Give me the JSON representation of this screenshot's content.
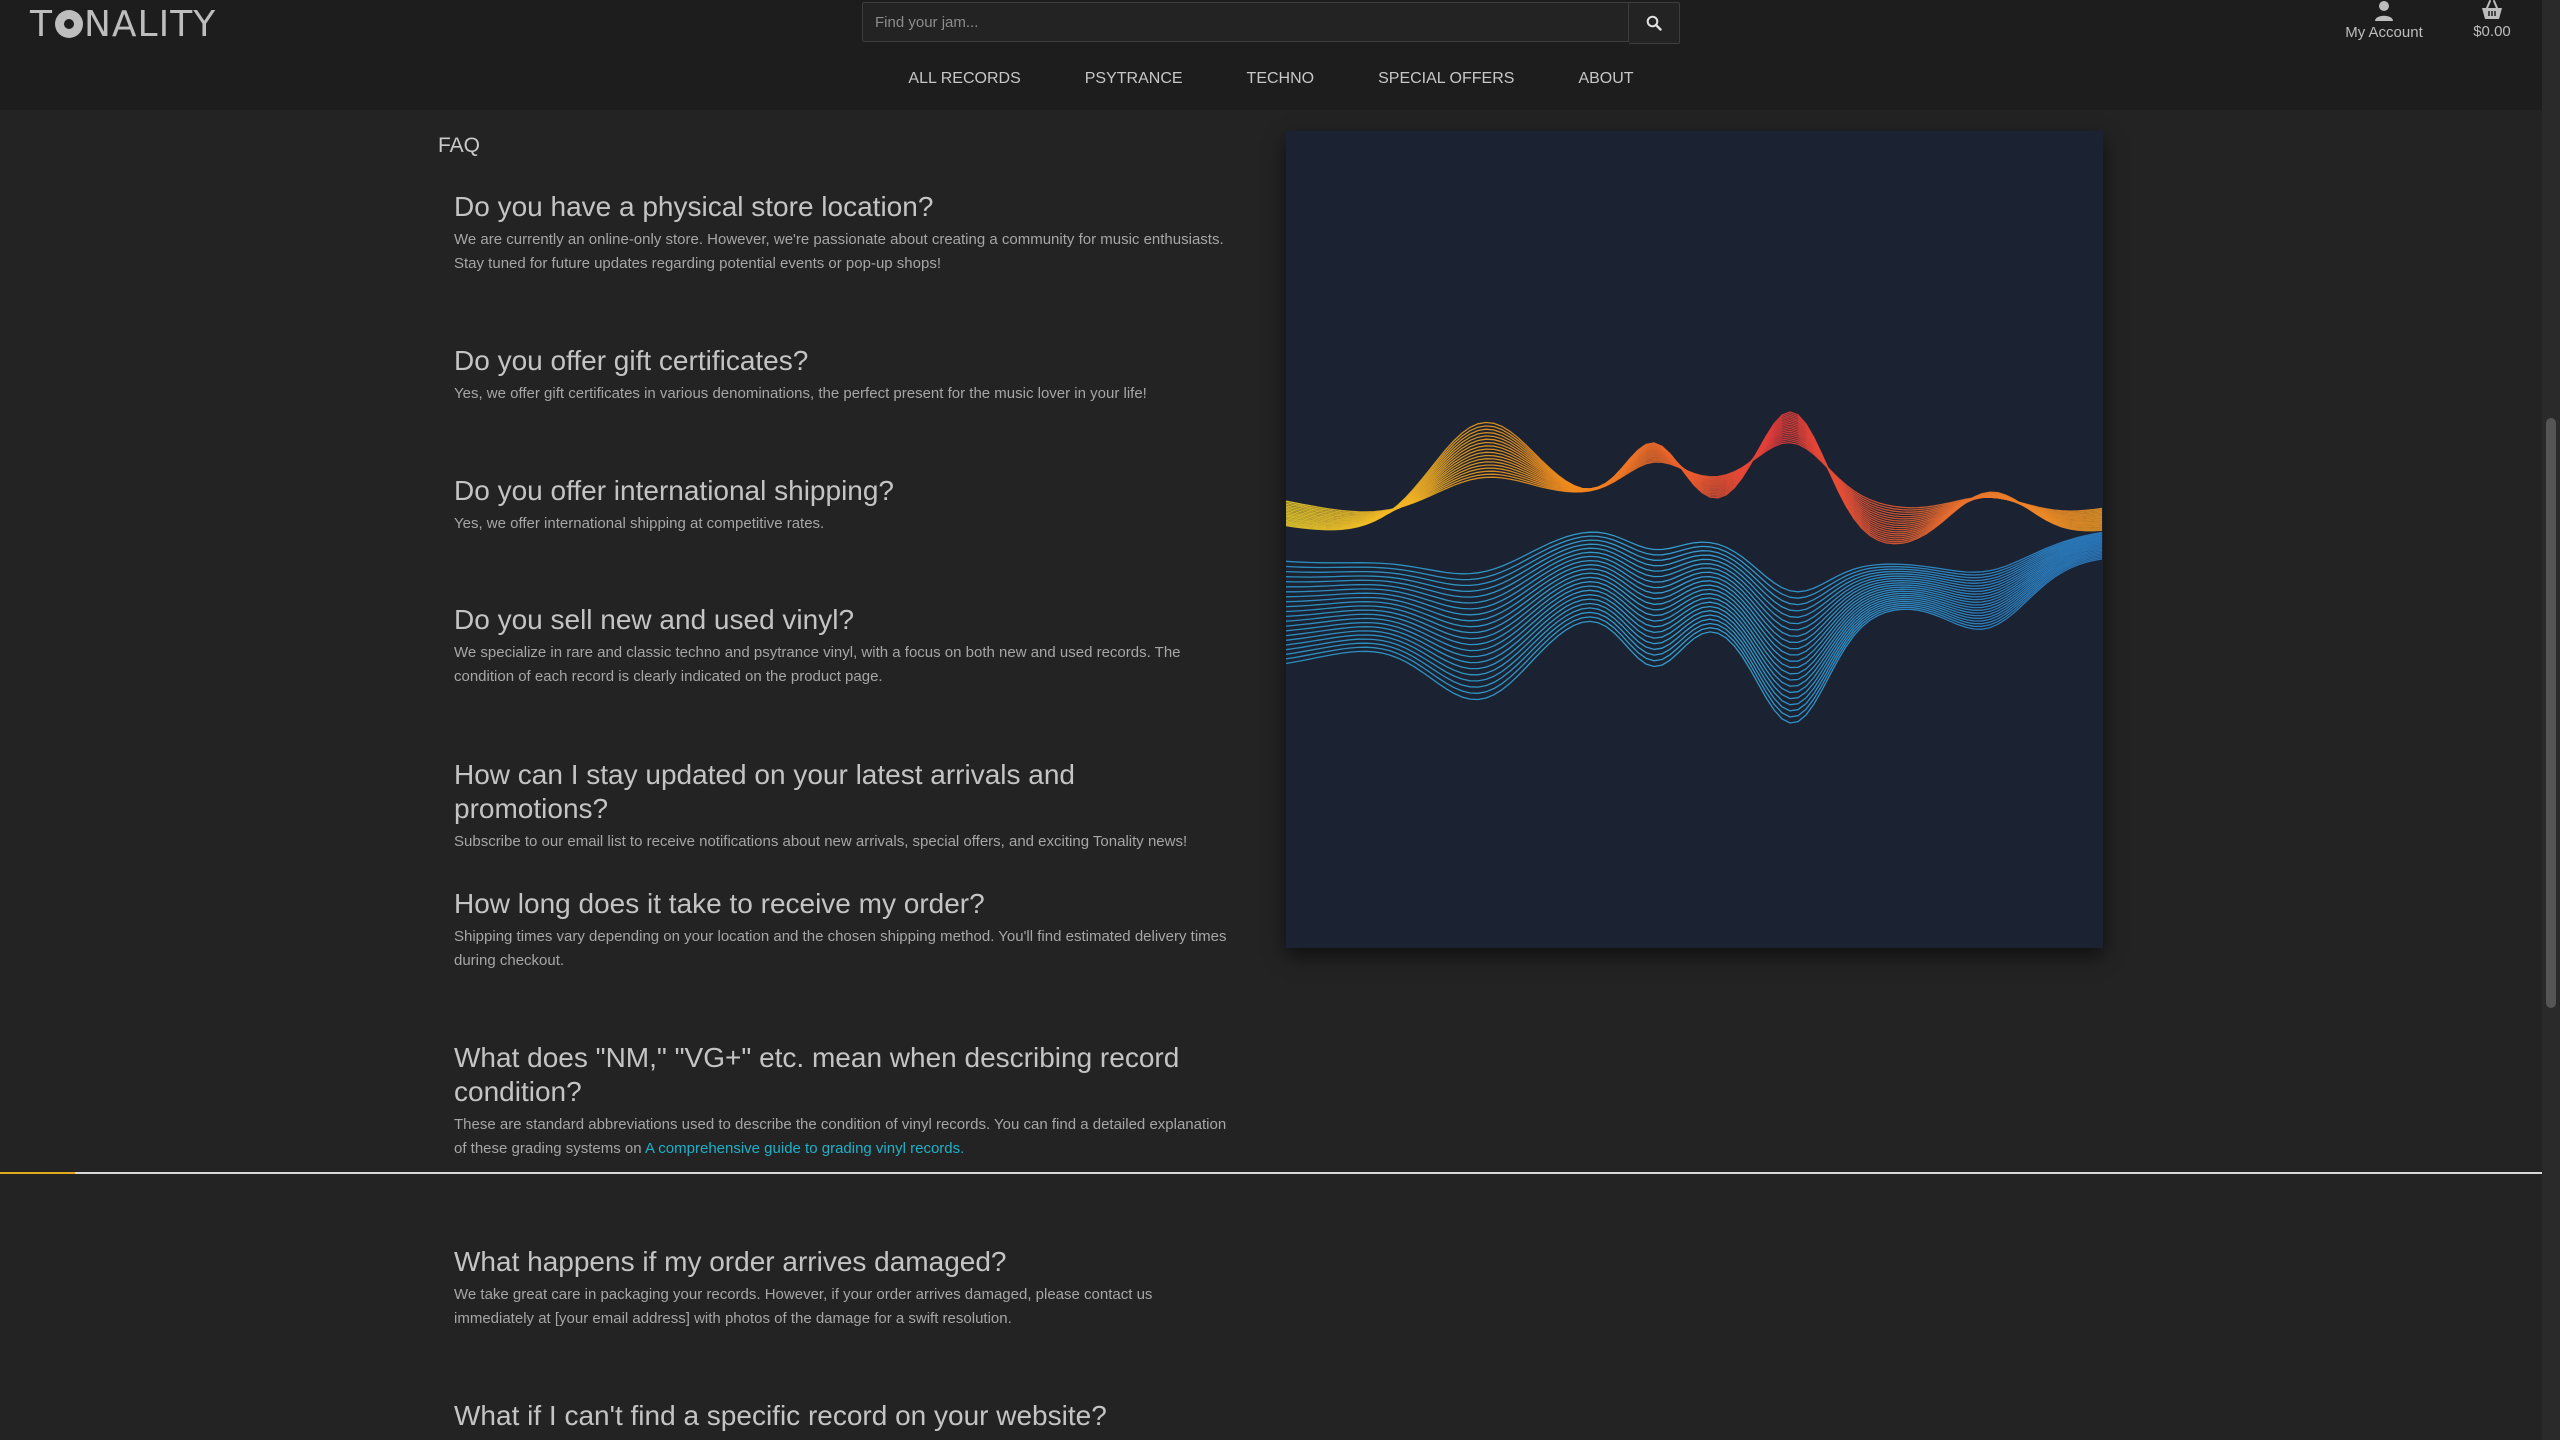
{
  "header": {
    "logo_text_pre": "T",
    "logo_text_post": "NALITY",
    "search": {
      "placeholder": "Find your jam..."
    },
    "account_label": "My Account",
    "cart_total": "$0.00",
    "icons": {
      "search": "search-icon",
      "account": "user-icon",
      "cart": "basket-icon"
    }
  },
  "nav": {
    "items": [
      {
        "label": "ALL RECORDS"
      },
      {
        "label": "PSYTRANCE"
      },
      {
        "label": "TECHNO"
      },
      {
        "label": "SPECIAL OFFERS"
      },
      {
        "label": "ABOUT"
      }
    ]
  },
  "main": {
    "section_label": "FAQ",
    "faqs": [
      {
        "q": "Do you have a physical store location?",
        "a": "We are currently an online-only store. However, we're passionate about creating a community for music enthusiasts. Stay tuned for future updates regarding potential events or pop-up shops!"
      },
      {
        "q": "Do you offer gift certificates?",
        "a": "Yes, we offer gift certificates in various denominations, the perfect present for the music lover in your life!"
      },
      {
        "q": "Do you offer international shipping?",
        "a": "Yes, we offer international shipping at competitive rates."
      },
      {
        "q": "Do you sell new and used vinyl?",
        "a": "We specialize in rare and classic techno and psytrance vinyl, with a focus on both new and used records. The condition of each record is clearly indicated on the product page."
      },
      {
        "q": "How can I stay updated on your latest arrivals and promotions?",
        "a": "Subscribe to our email list to receive notifications about new arrivals, special offers, and exciting Tonality news!"
      },
      {
        "q": "How long does it take to receive my order?",
        "a": "Shipping times vary depending on your location and the chosen shipping method. You'll find estimated delivery times during checkout."
      },
      {
        "q": "What does \"NM,\" \"VG+\" etc. mean when describing record condition?",
        "a": "These are standard abbreviations used to describe the condition of vinyl records. You can find a detailed explanation of these grading systems on ",
        "link": "A comprehensive guide to grading vinyl records."
      },
      {
        "q": "What happens if my order arrives damaged?",
        "a": "We take great care in packaging your records. However, if your order arrives damaged, please contact us immediately at [your email address] with photos of the damage for a swift resolution."
      },
      {
        "q": "What if I can't find a specific record on your website?",
        "a": ""
      }
    ]
  },
  "colors": {
    "background": "#232323",
    "header_bg": "#1d1d1d",
    "link": "#1fb0c8",
    "art_bg": "#1b2231",
    "accent": "#e0a81c"
  }
}
